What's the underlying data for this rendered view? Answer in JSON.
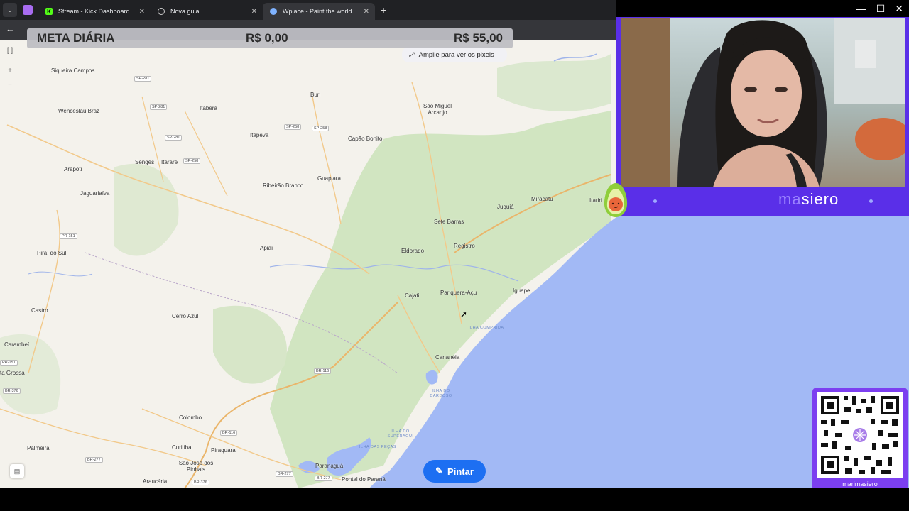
{
  "browser": {
    "tabs": [
      {
        "label": "Stream - Kick Dashboard",
        "icon": "kick-icon"
      },
      {
        "label": "Nova guia",
        "icon": "globe-icon"
      },
      {
        "label": "Wplace - Paint the world",
        "icon": "wplace-icon",
        "active": true
      }
    ],
    "new_tab_symbol": "+",
    "close_symbol": "✕",
    "back_symbol": "←"
  },
  "overlay": {
    "meta_title": "META DIÁRIA",
    "meta_current": "R$ 0,00",
    "meta_goal": "R$ 55,00"
  },
  "map": {
    "zoom_hint": "Amplie para ver os pixels",
    "paint_button": "Pintar",
    "places": [
      "Siqueira Campos",
      "Buri",
      "São Miguel Arcanjo",
      "Wenceslau Braz",
      "Itaberá",
      "Itapeva",
      "Capão Bonito",
      "Sengés",
      "Itararé",
      "Arapoti",
      "Guapiara",
      "Ribeirão Branco",
      "Jaguariaíva",
      "Miracatu",
      "Juquiá",
      "Itariri",
      "Sete Barras",
      "Piraí do Sul",
      "Apiaí",
      "Eldorado",
      "Registro",
      "Cajati",
      "Pariquera-Açu",
      "Iguape",
      "Castro",
      "Cerro Azul",
      "Carambeí",
      "Cananéia",
      "ta Grossa",
      "Colombo",
      "Palmeira",
      "Curitiba",
      "Piraquara",
      "São José dos Pinhais",
      "Paranaguá",
      "Araucária",
      "Pontal do Paraná"
    ],
    "roads": [
      "SP-281",
      "SP-281",
      "SP-281",
      "SP-258",
      "SP-258",
      "SP-258",
      "PR-151",
      "PR-151",
      "BR-376",
      "BR-116",
      "BR-116",
      "BR-277",
      "BR-277",
      "BR-277",
      "BR-376"
    ],
    "sea_labels": [
      "ILHA COMPRIDA",
      "ILHA DO CARDOSO",
      "ILHA DO SUPERAGUI",
      "ILHA DAS PEÇAS"
    ]
  },
  "stream": {
    "name_prefix": "ma",
    "name_rest": "siero",
    "qr_handle": "marimasiero"
  },
  "window_controls": [
    "—",
    "☐",
    "✕"
  ],
  "colors": {
    "accent": "#5a2fe8",
    "ocean": "#a2b9f5",
    "paint_button": "#1d6ff2",
    "land": "#f4f2ec"
  }
}
